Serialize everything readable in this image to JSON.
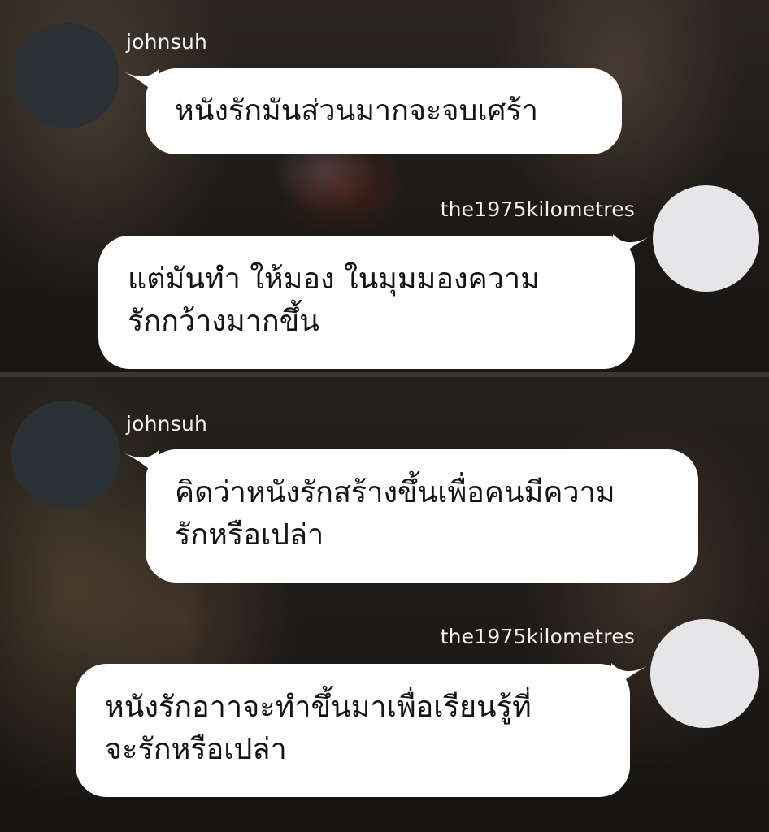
{
  "conversation": {
    "messages": [
      {
        "sender": "johnsuh",
        "side": "left",
        "avatar_color": "#2b3035",
        "lines": [
          "หนังรักมันส่วนมากจะจบเศร้า"
        ]
      },
      {
        "sender": "the1975kilometres",
        "side": "right",
        "avatar_color": "#e6e6e8",
        "lines": [
          "แต่มันทำ ให้มอง ในมุมมองความ",
          "รักกว้างมากขึ้น"
        ]
      },
      {
        "sender": "johnsuh",
        "side": "left",
        "avatar_color": "#2b3035",
        "lines": [
          "คิดว่าหนังรักสร้างขึ้นเพื่อคนมีความ",
          "รักหรือเปล่า"
        ]
      },
      {
        "sender": "the1975kilometres",
        "side": "right",
        "avatar_color": "#e6e6e8",
        "lines": [
          "หนังรักอาาจะทำขึ้นมาเพื่อเรียนรู้ที่",
          "จะรักหรือเปล่า"
        ]
      }
    ]
  },
  "colors": {
    "bubble": "#ffffff",
    "bubble_text": "#141414",
    "username_text": "#f2f2f2",
    "background": "#151311"
  }
}
